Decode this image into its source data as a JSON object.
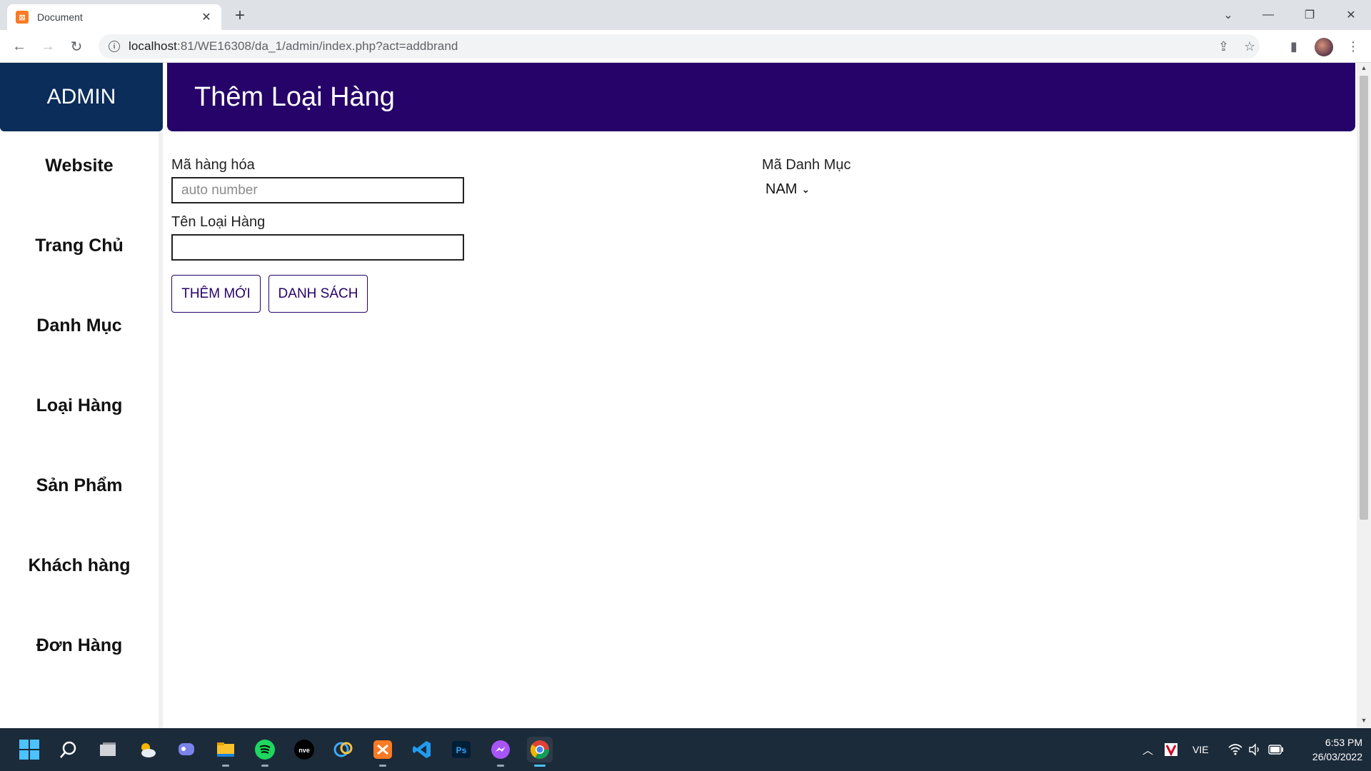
{
  "browser": {
    "tab_title": "Document",
    "tab_favicon": "xampp-icon",
    "url_host": "localhost",
    "url_path": ":81/WE16308/da_1/admin/index.php?act=addbrand"
  },
  "sidebar": {
    "header": "ADMIN",
    "items": [
      {
        "label": "Website"
      },
      {
        "label": "Trang Chủ"
      },
      {
        "label": "Danh Mục"
      },
      {
        "label": "Loại Hàng"
      },
      {
        "label": "Sản Phẩm"
      },
      {
        "label": "Khách hàng"
      },
      {
        "label": "Đơn Hàng"
      }
    ]
  },
  "page": {
    "title": "Thêm Loại Hàng"
  },
  "form": {
    "code_label": "Mã hàng hóa",
    "code_placeholder": "auto number",
    "name_label": "Tên Loại Hàng",
    "name_value": "",
    "category_label": "Mã Danh Mục",
    "category_selected": "NAM",
    "add_button": "THÊM MỚI",
    "list_button": "DANH SÁCH"
  },
  "taskbar": {
    "apps": [
      "windows-start-icon",
      "search-icon",
      "task-view-icon",
      "weather-icon",
      "teams-chat-icon",
      "file-explorer-icon",
      "spotify-icon",
      "nve-icon",
      "paint-icon",
      "xampp-icon",
      "vscode-icon",
      "photoshop-icon",
      "messenger-icon",
      "chrome-icon"
    ],
    "language": "VIE",
    "time": "6:53 PM",
    "date": "26/03/2022"
  },
  "colors": {
    "sidebar_header": "#0b2d5a",
    "page_header": "#250368",
    "button_border": "#250368"
  }
}
